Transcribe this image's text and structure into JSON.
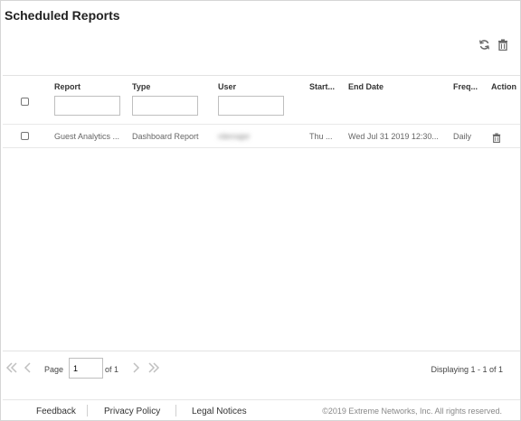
{
  "page": {
    "title": "Scheduled Reports"
  },
  "toolbar": {
    "refresh_icon": "refresh-icon",
    "delete_icon": "trash-icon"
  },
  "grid": {
    "columns": {
      "report": "Report",
      "type": "Type",
      "user": "User",
      "start": "Start...",
      "end_date": "End Date",
      "frequency": "Freq...",
      "action": "Action"
    },
    "filters": {
      "report": "",
      "type": "",
      "user": ""
    },
    "rows": [
      {
        "report": "Guest Analytics ...",
        "type": "Dashboard Report",
        "user": "rdemajer",
        "start": "Thu ...",
        "end_date": "Wed Jul 31 2019 12:30...",
        "frequency": "Daily",
        "action_icon": "trash-icon"
      }
    ]
  },
  "pager": {
    "page_label": "Page",
    "page_value": "1",
    "of_label": "of 1",
    "display_text": "Displaying 1 - 1 of 1"
  },
  "footer": {
    "feedback": "Feedback",
    "privacy": "Privacy Policy",
    "legal": "Legal Notices",
    "copyright": "©2019 Extreme Networks, Inc. All rights reserved."
  },
  "colors": {
    "icon": "#666666",
    "disabled_icon": "#c0c0c0",
    "border": "#d6d6d6"
  }
}
